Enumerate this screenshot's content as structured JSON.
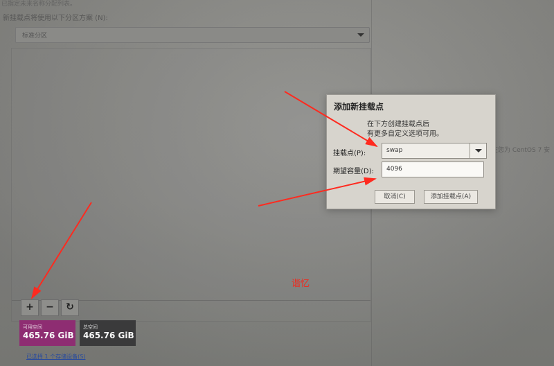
{
  "page": {
    "top_line": "已指定未来名称分配列表。",
    "partition_scheme_label": "新挂载点将使用以下分区方案 (N):",
    "partition_scheme_value": "标准分区",
    "side_note": "在您为 CentOS 7 安",
    "available_space_label": "可用空间",
    "available_space_value": "465.76 GiB",
    "total_space_label": "总空间",
    "total_space_value": "465.76 GiB",
    "storage_link": "已选择 1 个存储设备(S)",
    "toolbar": {
      "add_label": "+",
      "remove_label": "−",
      "refresh_label": "↻"
    }
  },
  "dialog": {
    "title": "添加新挂载点",
    "description_line_1": "在下方创建挂载点后",
    "description_line_2": "有更多自定义选项可用。",
    "mount_point_label": "挂载点(P):",
    "mount_point_value": "swap",
    "capacity_label": "期望容量(D):",
    "capacity_value": "4096",
    "cancel_label": "取消(C)",
    "add_label": "添加挂载点(A)"
  },
  "annotation": {
    "note": "谐忆",
    "arrow_color": "#ff2a1f"
  },
  "colors": {
    "available_space": "#8e2d72",
    "total_space": "#3a3a3b",
    "dialog_background": "#d7d4cd",
    "link": "#284a9e"
  }
}
